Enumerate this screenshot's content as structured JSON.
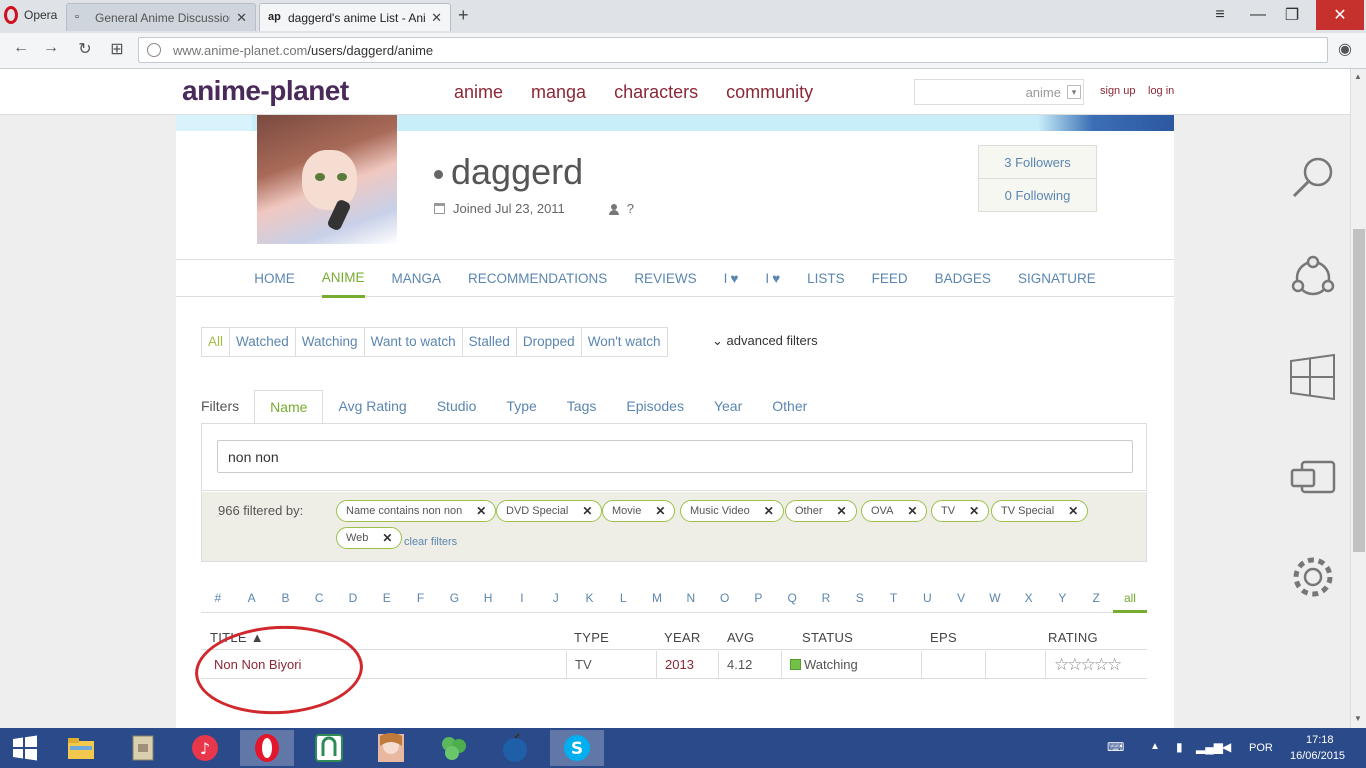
{
  "browser": {
    "menu_label": "Opera",
    "tabs": [
      {
        "title": "General Anime Discussion"
      },
      {
        "title": "daggerd's anime List - Ani"
      }
    ],
    "url_host": "www.anime-planet.com",
    "url_path": "/users/daggerd/anime"
  },
  "site": {
    "logo": "anime-planet",
    "nav": [
      "anime",
      "manga",
      "characters",
      "community"
    ],
    "search_scope": "anime",
    "signup": "sign up",
    "login": "log in"
  },
  "profile": {
    "username": "daggerd",
    "joined": "Joined Jul 23, 2011",
    "gender": "?",
    "followers": "3 Followers",
    "following": "0 Following"
  },
  "profile_nav": {
    "home": "HOME",
    "anime": "ANIME",
    "manga": "MANGA",
    "recommendations": "RECOMMENDATIONS",
    "reviews": "REVIEWS",
    "love": "I",
    "hate": "I",
    "lists": "LISTS",
    "feed": "FEED",
    "badges": "BADGES",
    "signature": "SIGNATURE"
  },
  "status_tabs": [
    "All",
    "Watched",
    "Watching",
    "Want to watch",
    "Stalled",
    "Dropped",
    "Won't watch"
  ],
  "advanced_filters": "advanced filters",
  "filter_label": "Filters",
  "filter_tabs": [
    "Name",
    "Avg Rating",
    "Studio",
    "Type",
    "Tags",
    "Episodes",
    "Year",
    "Other"
  ],
  "name_filter_value": "non non",
  "filtered_by": "966 filtered by:",
  "tags": [
    "Name contains non non",
    "DVD Special",
    "Movie",
    "Music Video",
    "Other",
    "OVA",
    "TV",
    "TV Special",
    "Web"
  ],
  "clear_filters": "clear filters",
  "alphabet": [
    "#",
    "A",
    "B",
    "C",
    "D",
    "E",
    "F",
    "G",
    "H",
    "I",
    "J",
    "K",
    "L",
    "M",
    "N",
    "O",
    "P",
    "Q",
    "R",
    "S",
    "T",
    "U",
    "V",
    "W",
    "X",
    "Y",
    "Z",
    "all"
  ],
  "table": {
    "headers": {
      "title": "TITLE ▲",
      "type": "TYPE",
      "year": "YEAR",
      "avg": "AVG",
      "status": "STATUS",
      "eps": "EPS",
      "rating": "RATING"
    },
    "rows": [
      {
        "title": "Non Non Biyori",
        "type": "TV",
        "year": "2013",
        "avg": "4.12",
        "status": "Watching",
        "eps": "",
        "rating": "☆☆☆☆☆"
      }
    ]
  },
  "taskbar": {
    "lang": "POR",
    "time": "17:18",
    "date": "16/06/2015"
  },
  "colors": {
    "brand": "#4a2a5a",
    "nav_link": "#8c2735",
    "accent_green": "#76ac2f",
    "link_blue": "#5b86b0",
    "annotation": "#d0282c"
  }
}
